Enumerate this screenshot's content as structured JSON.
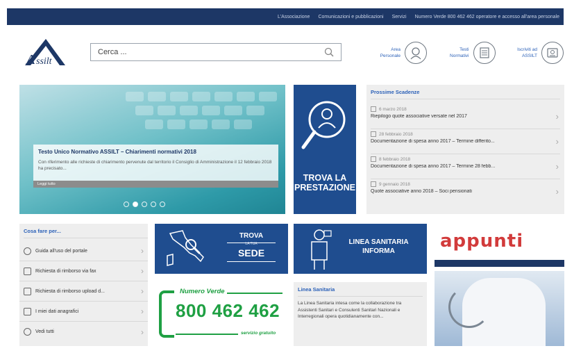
{
  "topbar": {
    "links": [
      "L'Associazione",
      "Comunicazioni e pubblicazioni",
      "Servizi",
      "Numero Verde 800 462 462 operatore e accesso all'area personale"
    ]
  },
  "header": {
    "logo_text": "Assilt",
    "search": {
      "placeholder": "Cerca ..."
    },
    "links": [
      {
        "label": "Area Personale",
        "icon": "user-icon"
      },
      {
        "label": "Testi Normativi",
        "icon": "document-icon"
      },
      {
        "label": "Iscriviti ad ASSILT",
        "icon": "register-icon"
      }
    ]
  },
  "hero": {
    "title": "Testo Unico Normativo ASSILT – Chiarimenti normativi 2018",
    "description": "Con riferimento alle richieste di chiarimento pervenute dal territorio il Consiglio di Amministrazione il 12 febbraio 2018 ha precisato...",
    "more_label": "Leggi tutto",
    "slides": 5,
    "active_slide": 1
  },
  "trova_prestazione": {
    "title": "TROVA LA PRESTAZIONE",
    "line1": "TROVA LA",
    "line2": "PRESTAZIONE",
    "icon": "search-person-icon"
  },
  "news": {
    "title": "Prossime Scadenze",
    "items": [
      {
        "date": "6 marzo 2018",
        "text": "Riepilogo quote associative versate nel 2017"
      },
      {
        "date": "28 febbraio 2018",
        "text": "Documentazione di spesa anno 2017 – Termine differito..."
      },
      {
        "date": "8 febbraio 2018",
        "text": "Documentazione di spesa anno 2017 – Termine 28 febb..."
      },
      {
        "date": "9 gennaio 2018",
        "text": "Quote associative anno 2018 – Soci pensionati"
      }
    ]
  },
  "cosa_fare": {
    "title": "Cosa fare per...",
    "items": [
      {
        "label": "Guida all'uso del portale",
        "icon": "user-icon"
      },
      {
        "label": "Richiesta di rimborso via fax",
        "icon": "fax-icon"
      },
      {
        "label": "Richiesta di rimborso upload d...",
        "icon": "upload-icon"
      },
      {
        "label": "I miei dati anagrafici",
        "icon": "monitor-icon"
      },
      {
        "label": "Vedi tutti",
        "icon": "plus-circle-icon"
      }
    ]
  },
  "trova_sede": {
    "line1": "TROVA",
    "line2": "LA TUA",
    "line3": "SEDE",
    "icon": "italy-map-icon"
  },
  "numero_verde": {
    "label": "Numero Verde",
    "number": "800 462 462",
    "sub": "servizio gratuito",
    "color": "#1fa043"
  },
  "linea_sanitaria": {
    "line1": "LINEA SANITARIA",
    "line2": "INFORMA",
    "icon": "doctor-icon"
  },
  "linea_box": {
    "title": "Linea Sanitaria",
    "description": "La Linea Sanitaria intesa come la collaborazione tra Assistenti Sanitari e Consulenti Sanitari Nazionali e Interregionali opera quotidianamente con..."
  },
  "appunti": {
    "word": "appunti"
  },
  "colors": {
    "navy": "#1d3766",
    "blue": "#1f4d8f",
    "link": "#2c61b8",
    "green": "#1fa043"
  }
}
